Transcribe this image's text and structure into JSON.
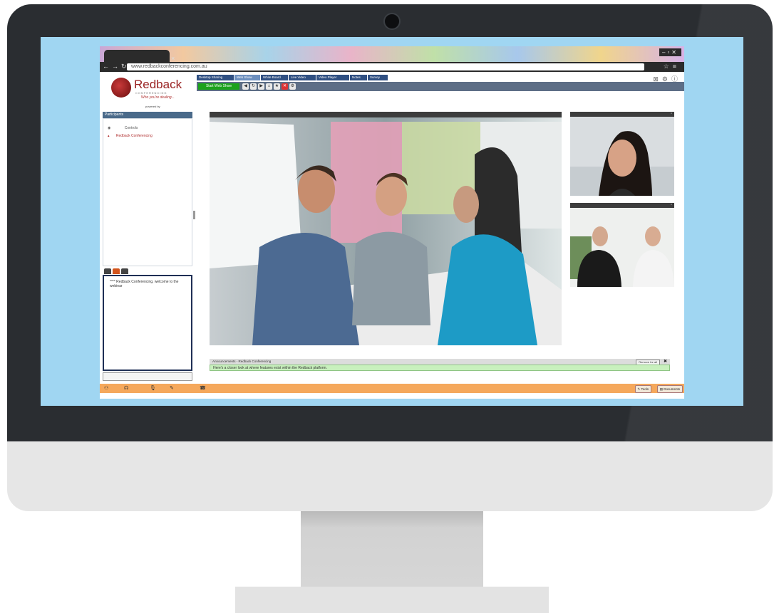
{
  "browser": {
    "url": "www.redbackconferencing.com.au"
  },
  "logo": {
    "name": "Redback",
    "sub": "CONFERENCING",
    "tagline": "Who you're dealing...",
    "powered": "powered by"
  },
  "participants": {
    "header": "Participants",
    "rows": [
      "Controls",
      "Redback Conferencing"
    ]
  },
  "chat": {
    "message": "**** Redback Conferencing, welcome to the webinar"
  },
  "tabs": [
    "Desktop Sharing",
    "Web Show",
    "White Board",
    "Live Video",
    "Video Player",
    "Notes",
    "Survey"
  ],
  "toolbar": {
    "start_label": "Start Web Show"
  },
  "announcements": {
    "header": "Announcements - Redback Conferencing",
    "button": "Remove for all",
    "body": "Here's a closer look at where features exist within the Redback platform."
  },
  "bottom": {
    "tools_label": "Tools",
    "documents_label": "Documents"
  },
  "colors": {
    "screen_bg": "#a0d6f2",
    "bezel": "#2a2d31",
    "accent_red": "#9a2323",
    "toolbar_blue": "#2f4f82",
    "bottom_bar": "#f5a85c",
    "announce_bg": "#c8f0bd"
  }
}
